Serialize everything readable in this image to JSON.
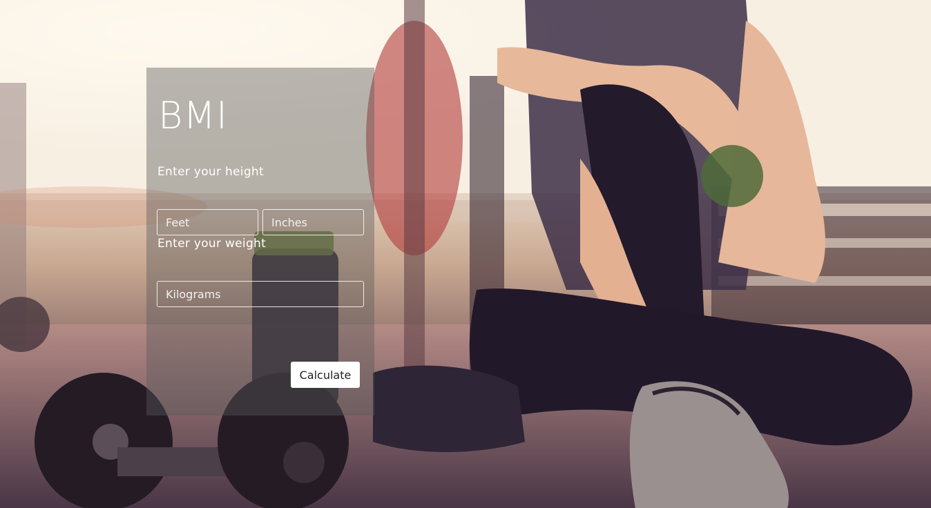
{
  "app": {
    "title": "BMI"
  },
  "form": {
    "height_label": "Enter your height",
    "feet_placeholder": "Feet",
    "inches_placeholder": "Inches",
    "weight_label": "Enter your weight",
    "kg_placeholder": "Kilograms",
    "calculate_label": "Calculate"
  },
  "colors": {
    "card_overlay": "rgba(90,90,90,0.42)",
    "text": "#ffffff",
    "button_bg": "#ffffff",
    "button_text": "#222222"
  }
}
